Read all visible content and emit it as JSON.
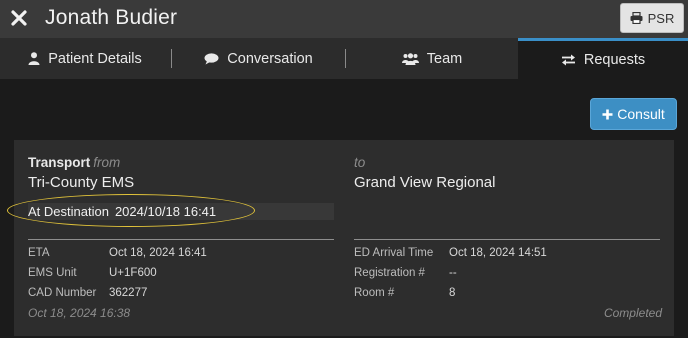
{
  "header": {
    "title": "Jonath Budier",
    "psr_label": "PSR"
  },
  "tabs": [
    {
      "label": "Patient Details",
      "icon": "user-icon"
    },
    {
      "label": "Conversation",
      "icon": "chat-icon"
    },
    {
      "label": "Team",
      "icon": "team-icon"
    },
    {
      "label": "Requests",
      "icon": "swap-arrows-icon",
      "active": true
    }
  ],
  "consult": {
    "label": "Consult"
  },
  "transport": {
    "title": "Transport",
    "from_label": "from",
    "origin": "Tri-County EMS",
    "to_label": "to",
    "destination": "Grand View Regional",
    "status_label": "At Destination",
    "status_datetime": "2024/10/18 16:41",
    "left_fields": [
      {
        "label": "ETA",
        "value": "Oct 18, 2024 16:41"
      },
      {
        "label": "EMS Unit",
        "value": "U+1F600"
      },
      {
        "label": "CAD Number",
        "value": "362277"
      }
    ],
    "right_fields": [
      {
        "label": "ED Arrival Time",
        "value": "Oct 18, 2024 14:51"
      },
      {
        "label": "Registration #",
        "value": "--"
      },
      {
        "label": "Room #",
        "value": "8"
      }
    ],
    "created": "Oct 18, 2024 16:38",
    "state": "Completed"
  },
  "colors": {
    "accent": "#3d8fc4",
    "highlight": "#e0c23a",
    "header_bg": "#3a3a3a",
    "card_bg": "#2d2d2d"
  }
}
